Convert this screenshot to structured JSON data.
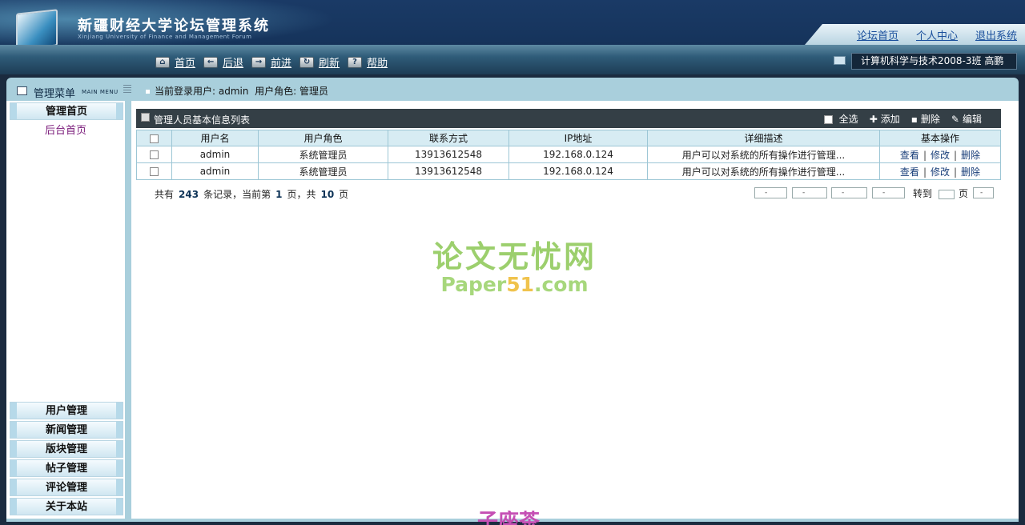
{
  "header": {
    "title": "新疆财经大学论坛管理系统",
    "subtitle": "Xinjiang University of Finance and Management Forum",
    "top_links": [
      "论坛首页",
      "个人中心",
      "退出系统"
    ],
    "toolbar": [
      {
        "icon": "home-icon",
        "glyph": "⌂",
        "label": "首页"
      },
      {
        "icon": "back-arrow-icon",
        "glyph": "←",
        "label": "后退"
      },
      {
        "icon": "forward-arrow-icon",
        "glyph": "→",
        "label": "前进"
      },
      {
        "icon": "refresh-icon",
        "glyph": "↻",
        "label": "刷新"
      },
      {
        "icon": "help-icon",
        "glyph": "?",
        "label": "帮助"
      }
    ],
    "user_box": "计算机科学与技术2008-3班    高鹏"
  },
  "menu": {
    "title": "管理菜单",
    "title_en": "MAIN MENU",
    "home": "管理首页",
    "home_sub": "后台首页",
    "items": [
      "用户管理",
      "新闻管理",
      "版块管理",
      "帖子管理",
      "评论管理",
      "关于本站"
    ]
  },
  "info": {
    "user_label": "当前登录用户:",
    "user": "admin",
    "role_label": "用户角色:",
    "role": "管理员"
  },
  "list": {
    "title": "管理人员基本信息列表",
    "actions": {
      "select_all": "全选",
      "add": "添加",
      "delete": "删除",
      "edit": "编辑"
    },
    "columns": [
      "",
      "用户名",
      "用户角色",
      "联系方式",
      "IP地址",
      "详细描述",
      "基本操作"
    ],
    "rows": [
      {
        "username": "admin",
        "role": "系统管理员",
        "contact": "13913612548",
        "ip": "192.168.0.124",
        "desc": "用户可以对系统的所有操作进行管理...",
        "ops": [
          "查看",
          "修改",
          "删除"
        ]
      },
      {
        "username": "admin",
        "role": "系统管理员",
        "contact": "13913612548",
        "ip": "192.168.0.124",
        "desc": "用户可以对系统的所有操作进行管理...",
        "ops": [
          "查看",
          "修改",
          "删除"
        ]
      }
    ]
  },
  "pager": {
    "prefix": "共有",
    "total": "243",
    "mid1": "条记录，当前第",
    "current": "1",
    "mid2": "页，共",
    "pages": "10",
    "suffix": "页",
    "goto_label": "转到",
    "page_unit": "页",
    "btn": "-"
  },
  "watermark": {
    "cn": "论文无忧网",
    "en_a": "Paper",
    "en_num": "51",
    "en_b": ".com"
  },
  "bottom_mark": "子座茶"
}
